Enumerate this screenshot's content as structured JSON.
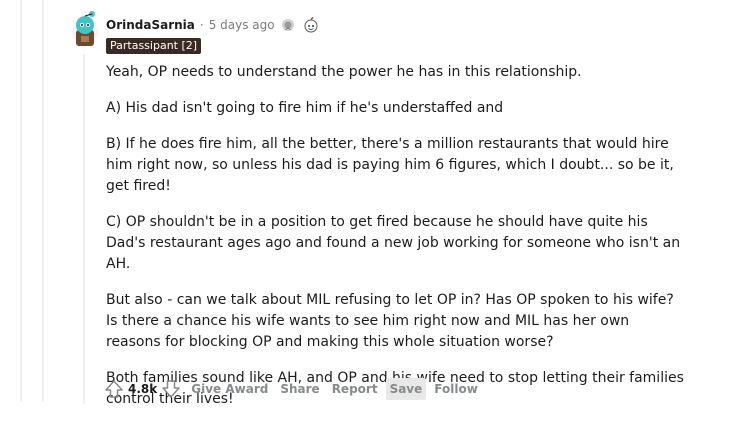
{
  "comment": {
    "author": "OrindaSarnia",
    "separator": "·",
    "time": "5 days ago",
    "flair": "Partassipant [2]",
    "paragraphs": [
      "Yeah, OP needs to understand the power he has in this relationship.",
      "A) His dad isn't going to fire him if he's understaffed and",
      "B) If he does fire him, all the better, there's a million restaurants that would hire him right now, so unless his dad is paying him 6 figures, which I doubt... so be it, get fired!",
      "C) OP shouldn't be in a position to get fired because he should have quite his Dad's restaurant ages ago and found a new job working for someone who isn't an AH.",
      "But also - can we talk about MIL refusing to let OP in? Has OP spoken to his wife? Is there a chance his wife wants to see him right now and MIL has her own reasons for blocking OP and making this whole situation worse?",
      "Both families sound like AH, and OP and his wife need to stop letting their families control their lives!"
    ],
    "score": "4.8k",
    "actions": {
      "give_award": "Give Award",
      "share": "Share",
      "report": "Report",
      "save": "Save",
      "follow": "Follow"
    }
  },
  "icons": [
    "avatar",
    "award-icon",
    "wholesome-award-icon",
    "upvote-icon",
    "downvote-icon"
  ],
  "colors": {
    "flair_bg": "#3a2a24",
    "muted_text": "#878a8c",
    "avatar_teal": "#3fc4c7"
  }
}
